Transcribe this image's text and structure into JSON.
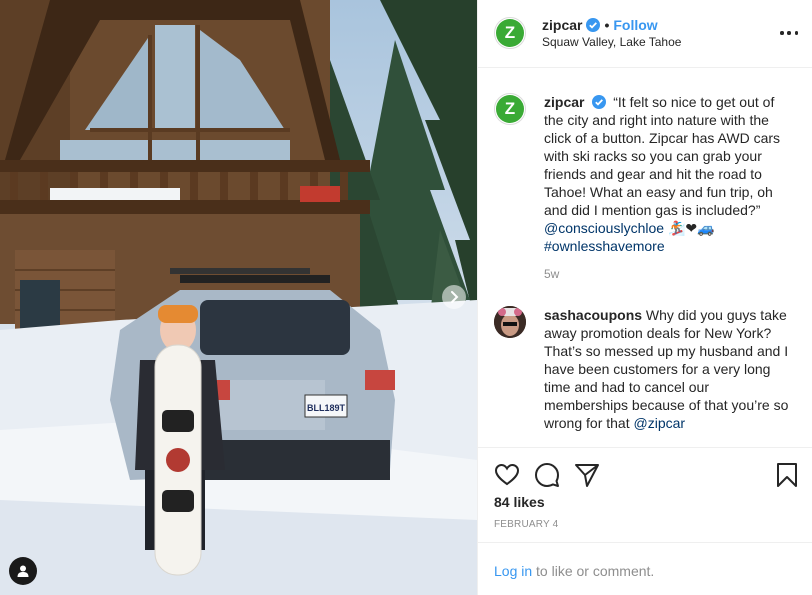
{
  "photo": {
    "license_plate": "BLL189T"
  },
  "header": {
    "username": "zipcar",
    "dot": "•",
    "follow_label": "Follow",
    "location": "Squaw Valley, Lake Tahoe",
    "avatar_letter": "Z"
  },
  "caption": {
    "username": "zipcar",
    "text": "“It felt so nice to get out of the city and right into nature with the click of a button. Zipcar has AWD cars with ski racks so you can grab your friends and gear and hit the road to Tahoe! What an easy and fun trip, oh and did I mention gas is included?”",
    "mention": "@consciouslychloe",
    "emoji": "🏂❤🚙",
    "hashtag": "#ownlesshavemore",
    "time": "5w"
  },
  "comment": {
    "username": "sashacoupons",
    "text": "Why did you guys take away promotion deals for New York? That’s so messed up my husband and I have been customers for a very long time and had to cancel our memberships because of that you’re so wrong for that",
    "mention": "@zipcar"
  },
  "actions": {
    "icons": [
      "heart-icon",
      "comment-icon",
      "share-icon",
      "bookmark-icon"
    ],
    "likes": "84 likes",
    "date": "FEBRUARY 4"
  },
  "login": {
    "link_label": "Log in",
    "text": "to like or comment."
  },
  "colors": {
    "link_blue": "#3897f0",
    "brand_green": "#3aaa35",
    "text": "#262626",
    "muted": "#8e8e8e"
  }
}
